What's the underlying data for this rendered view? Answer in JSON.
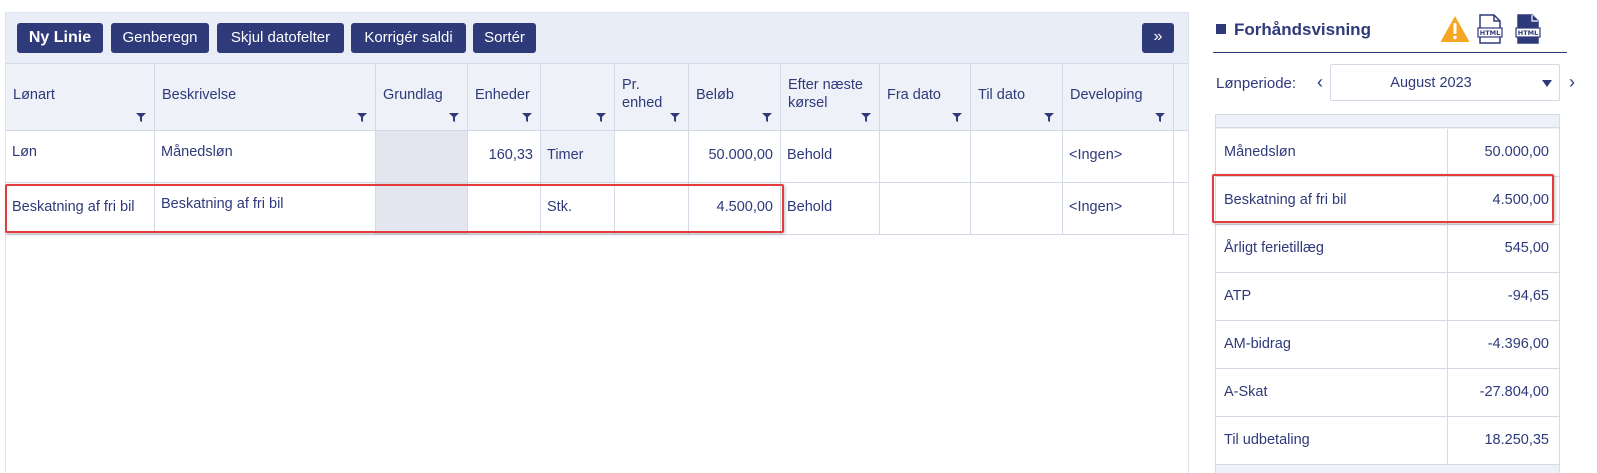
{
  "toolbar": {
    "new_line": "Ny Linie",
    "recalculate": "Genberegn",
    "hide_date_fields": "Skjul datofelter",
    "correct_balances": "Korrigér saldi",
    "sort": "Sortér",
    "more": "»"
  },
  "grid": {
    "columns": [
      {
        "line1": "Lønart",
        "line2": ""
      },
      {
        "line1": "Beskrivelse",
        "line2": ""
      },
      {
        "line1": "Grundlag",
        "line2": ""
      },
      {
        "line1": "Enheder",
        "line2": ""
      },
      {
        "line1": "",
        "line2": ""
      },
      {
        "line1": "Pr.",
        "line2": "enhed"
      },
      {
        "line1": "Beløb",
        "line2": ""
      },
      {
        "line1": "Efter næste",
        "line2": "kørsel"
      },
      {
        "line1": "Fra dato",
        "line2": ""
      },
      {
        "line1": "Til dato",
        "line2": ""
      },
      {
        "line1": "Developing",
        "line2": ""
      },
      {
        "line1": "",
        "line2": ""
      }
    ],
    "rows": [
      {
        "wage_type": "Løn",
        "description": "Månedsløn",
        "basis": "",
        "units": "160,33",
        "unit_type": "Timer",
        "per_unit": "",
        "amount": "50.000,00",
        "after_next_run": "Behold",
        "from_date": "",
        "to_date": "",
        "developing": "<Ingen>"
      },
      {
        "wage_type": "Beskatning af fri bil",
        "description": "Beskatning af fri bil",
        "basis": "",
        "units": "",
        "unit_type": "Stk.",
        "per_unit": "",
        "amount": "4.500,00",
        "after_next_run": "Behold",
        "from_date": "",
        "to_date": "",
        "developing": "<Ingen>"
      }
    ]
  },
  "preview": {
    "title": "Forhåndsvisning",
    "icons": [
      "warning-icon",
      "html-export-icon",
      "html-dark-export-icon"
    ],
    "period_label": "Lønperiode:",
    "period_value": "August 2023",
    "rows": [
      {
        "label": "Månedsløn",
        "value": "50.000,00"
      },
      {
        "label": "Beskatning af fri bil",
        "value": "4.500,00"
      },
      {
        "label": "Årligt ferietillæg",
        "value": "545,00"
      },
      {
        "label": "ATP",
        "value": "-94,65"
      },
      {
        "label": "AM-bidrag",
        "value": "-4.396,00"
      },
      {
        "label": "A-Skat",
        "value": "-27.804,00"
      },
      {
        "label": "Til udbetaling",
        "value": "18.250,35"
      }
    ]
  },
  "colors": {
    "primary": "#2e3a7a",
    "header_bg": "#eef1f8",
    "highlight": "#e23c3c",
    "warning": "#f5a623"
  }
}
